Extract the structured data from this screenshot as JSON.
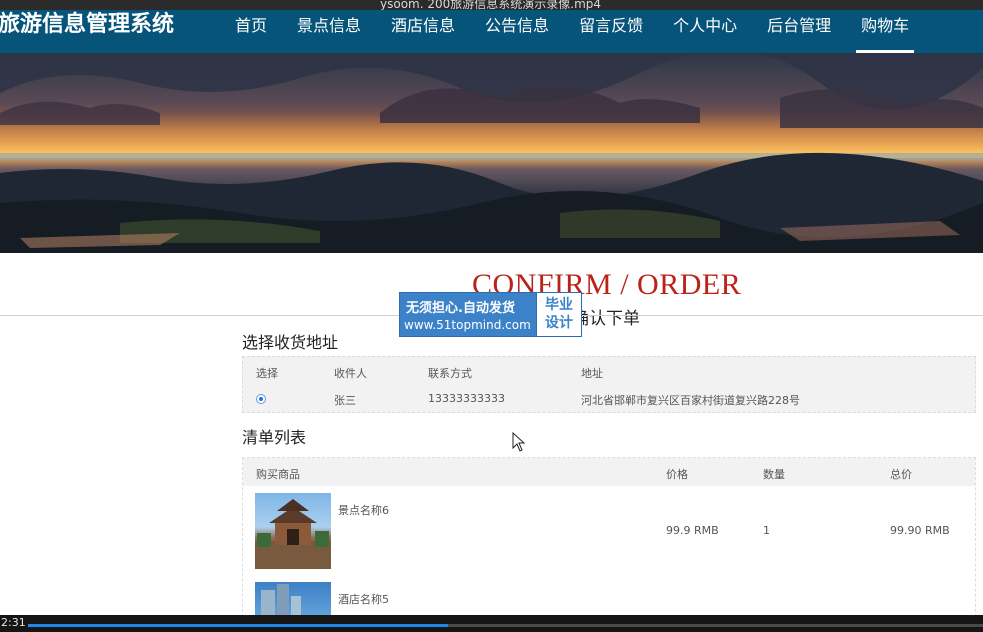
{
  "window": {
    "title_fragment": "ysoom. 200旅游信息系统演示录像.mp4"
  },
  "header": {
    "brand": "旅游信息管理系统",
    "nav": [
      "首页",
      "景点信息",
      "酒店信息",
      "公告信息",
      "留言反馈",
      "个人中心",
      "后台管理",
      "购物车"
    ],
    "active_nav": "购物车"
  },
  "page": {
    "title_en": "CONFIRM / ORDER",
    "title_cn": "确认下单"
  },
  "watermark": {
    "line1": "无须担心.自动发货",
    "line2": "www.51topmind.com",
    "badge_line1": "毕业",
    "badge_line2": "设计"
  },
  "address": {
    "section_title": "选择收货地址",
    "headers": {
      "select": "选择",
      "recipient": "收件人",
      "contact": "联系方式",
      "address": "地址"
    },
    "rows": [
      {
        "selected": true,
        "recipient": "张三",
        "contact": "13333333333",
        "address": "河北省邯郸市复兴区百家村街道复兴路228号"
      }
    ]
  },
  "list": {
    "section_title": "清单列表",
    "headers": {
      "product": "购买商品",
      "price": "价格",
      "qty": "数量",
      "total": "总价"
    },
    "items": [
      {
        "name": "景点名称6",
        "price": "99.9 RMB",
        "qty": "1",
        "total": "99.90 RMB"
      },
      {
        "name": "酒店名称5",
        "price": "",
        "qty": "",
        "total": ""
      }
    ]
  },
  "player": {
    "time": "2:31",
    "progress_fraction": 0.44
  },
  "colors": {
    "header_bg": "#06547a",
    "title_red": "#b8231a",
    "accent_blue": "#1e88e5",
    "watermark_blue": "#3b82c8"
  }
}
